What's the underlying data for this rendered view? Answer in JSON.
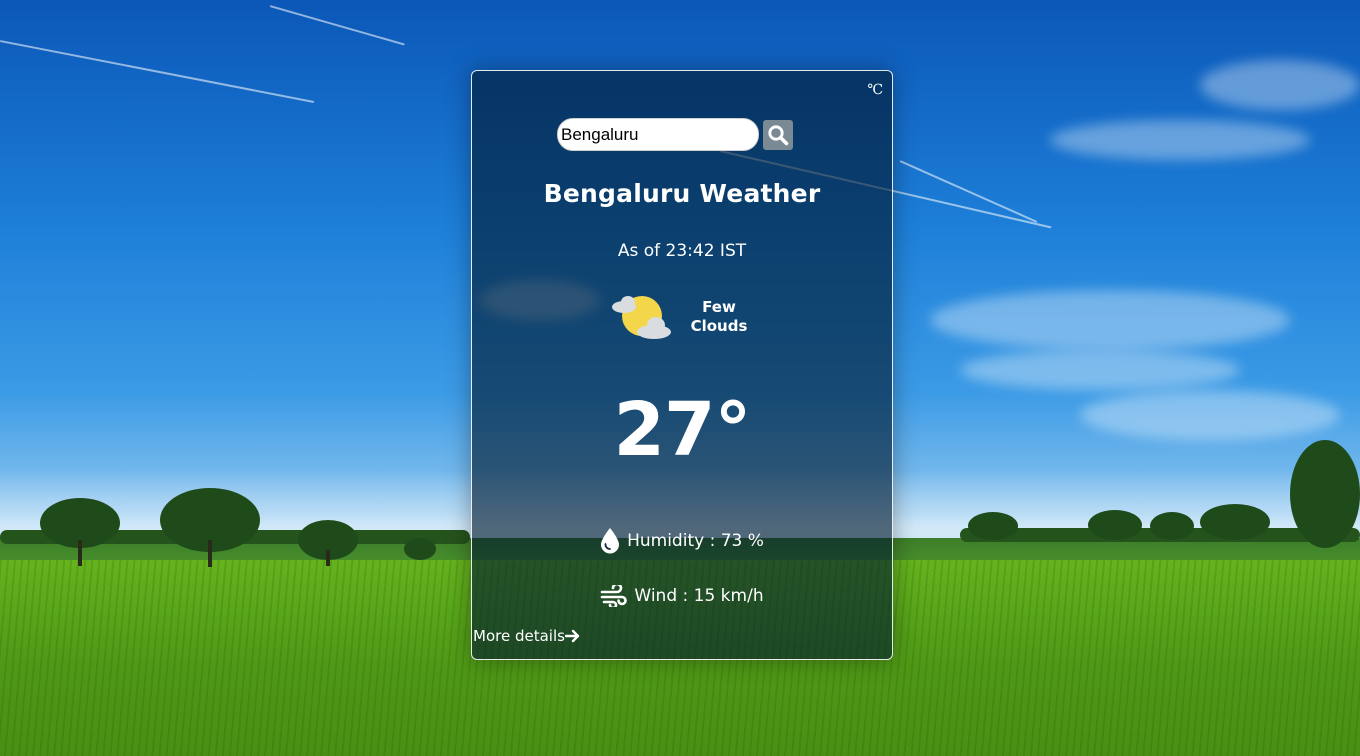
{
  "unit_toggle": {
    "label": "℃"
  },
  "search": {
    "value": "Bengaluru",
    "icon": "search-icon"
  },
  "location": {
    "title": "Bengaluru Weather"
  },
  "updated": {
    "text": "As of 23:42 IST"
  },
  "condition": {
    "icon": "few-clouds-icon",
    "label": "Few Clouds"
  },
  "current": {
    "temperature": "27°"
  },
  "stats": {
    "humidity_label": "Humidity : 73 %",
    "wind_label": "Wind : 15 km/h"
  },
  "footer": {
    "more_details": "More details"
  },
  "colors": {
    "card_background": "#00192d",
    "card_border": "#ffffff",
    "search_button": "#7a8a94",
    "sun": "#f4d64a",
    "cloud": "#d9dde0"
  }
}
